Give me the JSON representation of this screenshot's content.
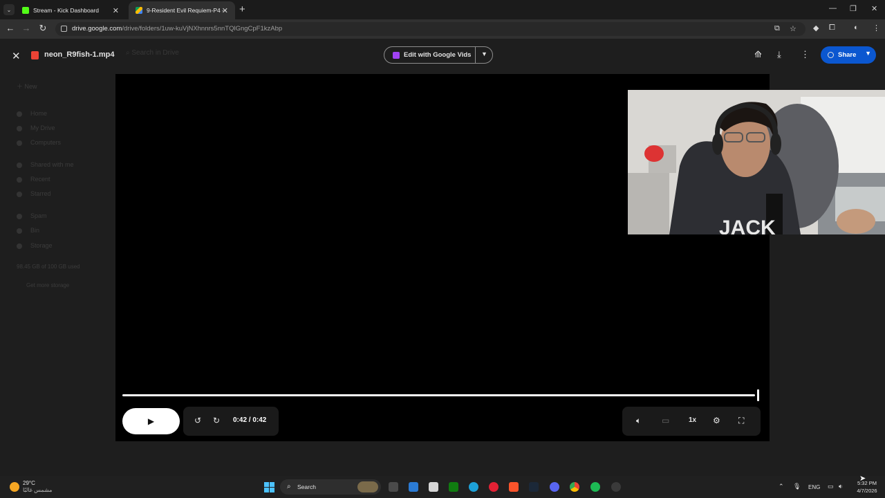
{
  "browser": {
    "tabs": [
      {
        "title": "Stream - Kick Dashboard",
        "active": false,
        "icon": "kick-icon",
        "color": "#53fc18"
      },
      {
        "title": "9-Resident Evil Requiem-P4 - G",
        "active": true,
        "icon": "google-drive-icon"
      }
    ],
    "url_host": "drive.google.com",
    "url_path": "/drive/folders/1uw-kuVjNXhnnrs5nnTQlGngCpF1kzAbp"
  },
  "drive_sidebar": {
    "new_label": "New",
    "items": [
      "Home",
      "My Drive",
      "Computers",
      "Shared with me",
      "Recent",
      "Starred",
      "Spam",
      "Bin",
      "Storage"
    ],
    "storage_used": "98.45 GB of 100 GB used",
    "get_storage": "Get more storage"
  },
  "viewer": {
    "filename": "neon_R9fish-1.mp4",
    "search_placeholder": "Search in Drive",
    "edit_label": "Edit with Google Vids",
    "share_label": "Share",
    "time_display": "0:42 / 0:42",
    "speed_label": "1x",
    "progress": 1.0
  },
  "taskbar": {
    "temperature": "29°C",
    "condition": "مشمس غالبًا",
    "search_label": "Search",
    "language": "ENG",
    "time": "5:32 PM",
    "date": "4/7/2026",
    "accent": "#4cc2ff"
  }
}
